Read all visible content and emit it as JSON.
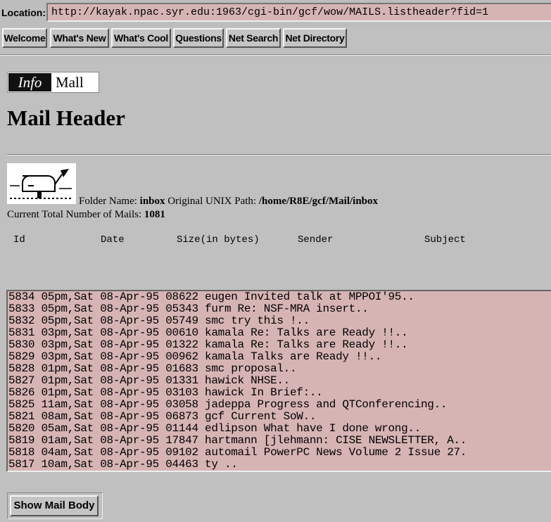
{
  "location": {
    "label": "Location:",
    "url": "http://kayak.npac.syr.edu:1963/cgi-bin/gcf/wow/MAILS.listheader?fid=1"
  },
  "directory_buttons": [
    "Welcome",
    "What's New",
    "What's Cool",
    "Questions",
    "Net Search",
    "Net Directory"
  ],
  "logo": {
    "left": "Info",
    "right": "Mall"
  },
  "page": {
    "title": "Mail Header",
    "folder_label": "Folder Name:",
    "folder_name": "inbox",
    "path_label": "Original UNIX Path:",
    "path": "/home/R8E/gcf/Mail/inbox",
    "count_label": "Current Total Number of Mails:",
    "count": "1081"
  },
  "columns": [
    "Id",
    "Date",
    "Size(in bytes)",
    "Sender",
    "Subject"
  ],
  "mails": [
    "5834 05pm,Sat 08-Apr-95 08622 eugen Invited talk at MPPOI'95..",
    "5833 05pm,Sat 08-Apr-95 05343 furm Re: NSF-MRA insert..",
    "5832 05pm,Sat 08-Apr-95 05749 smc try this !..",
    "5831 03pm,Sat 08-Apr-95 00610 kamala Re: Talks are Ready !!..",
    "5830 03pm,Sat 08-Apr-95 01322 kamala Re: Talks are Ready !!..",
    "5829 03pm,Sat 08-Apr-95 00962 kamala Talks are Ready !!..",
    "5828 01pm,Sat 08-Apr-95 01683 smc proposal..",
    "5827 01pm,Sat 08-Apr-95 01331 hawick NHSE..",
    "5826 01pm,Sat 08-Apr-95 03103 hawick In Brief:..",
    "5825 11am,Sat 08-Apr-95 03058 jadeppa Progress and QTConferencing..",
    "5821 08am,Sat 08-Apr-95 06873 gcf Current SoW..",
    "5820 05am,Sat 08-Apr-95 01144 edlipson What have I done wrong..",
    "5819 01am,Sat 08-Apr-95 17847 hartmann [jlehmann: CISE NEWSLETTER, A..",
    "5818 04am,Sat 08-Apr-95 09102 automail PowerPC News Volume 2 Issue 27.",
    "5817 10am,Sat 08-Apr-95 04463 ty .."
  ],
  "show_button": "Show Mail Body",
  "icons": {
    "mailbox": "mailbox-icon"
  },
  "colors": {
    "background": "#c0c0c0",
    "list_background": "#d7b4b4",
    "location_background": "#d7b4b4"
  }
}
